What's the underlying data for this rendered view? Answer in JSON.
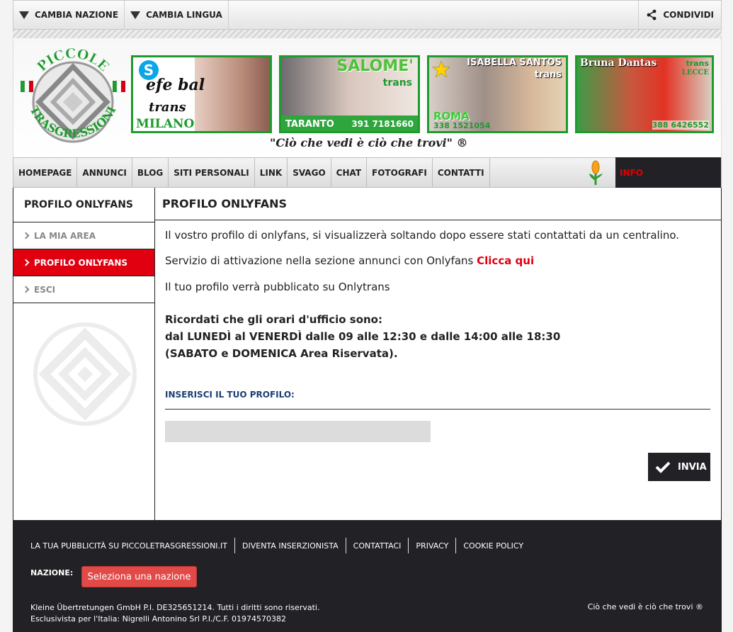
{
  "topbar": {
    "change_country": "CAMBIA NAZIONE",
    "change_language": "CAMBIA LINGUA",
    "share": "CONDIVIDI"
  },
  "header": {
    "logo_text_top": "PICCOLE",
    "logo_text_bottom": "TRASGRESSIONI",
    "slogan": "\"Ciò che vedi è ciò che trovi\" ®",
    "banners": [
      {
        "line1": "efe bal",
        "line2": "trans",
        "city": "MILANO"
      },
      {
        "name": "SALOME'",
        "type": "trans",
        "city": "TARANTO",
        "phone": "391 7181660"
      },
      {
        "name": "ISABELLA SANTOS",
        "type": "trans",
        "city": "ROMA",
        "phone": "338 1521054"
      },
      {
        "name": "Bruna Dantas",
        "type": "trans",
        "city": "LECCE",
        "phone": "388 6426552"
      }
    ]
  },
  "nav": {
    "items": [
      "HOMEPAGE",
      "ANNUNCI",
      "BLOG",
      "SITI PERSONALI",
      "LINK",
      "SVAGO",
      "CHAT",
      "FOTOGRAFI",
      "CONTATTI"
    ],
    "info": "INFO"
  },
  "sidebar": {
    "title": "PROFILO ONLYFANS",
    "items": [
      {
        "label": "LA MIA AREA",
        "active": false
      },
      {
        "label": "PROFILO ONLYFANS",
        "active": true
      },
      {
        "label": "ESCI",
        "active": false
      }
    ]
  },
  "main": {
    "title": "PROFILO ONLYFANS",
    "p1": "Il vostro profilo di onlyfans, si visualizzerà soltando dopo essere stati contattati da un centralino.",
    "p2_text": "Servizio di attivazione nella sezione annunci con Onlyfans ",
    "p2_link": "Clicca qui",
    "p3": "Il tuo profilo verrà pubblicato su Onlytrans",
    "hours1": "Ricordati che gli orari d'ufficio sono:",
    "hours2": "dal LUNEDÌ al VENERDÌ dalle 09 alle 12:30 e dalle 14:00 alle 18:30",
    "hours3": "(SABATO e DOMENICA Area Riservata).",
    "input_label": "INSERISCI IL TUO PROFILO:",
    "input_value": "",
    "submit": "INVIA"
  },
  "footer": {
    "links": [
      "LA TUA PUBBLICITÀ SU PICCOLETRASGRESSIONI.IT",
      "DIVENTA INSERZIONISTA",
      "CONTATTACI",
      "PRIVACY",
      "COOKIE POLICY"
    ],
    "nation_label": "NAZIONE:",
    "nation_select": "Seleziona una nazione",
    "copyright1": "Kleine Übertretungen GmbH  P.I. DE325651214.  Tutti i diritti sono riservati.",
    "copyright2": "Esclusivista per l'Italia:  Nigrelli Antonino Srl  P.I./C.F. 01974570382",
    "slogan": "Ciò che vedi è ciò che trovi ®"
  },
  "colors": {
    "accent_red": "#e00010",
    "dark": "#222226",
    "banner_green": "#1f9a2e",
    "label_blue": "#1c3f77"
  }
}
